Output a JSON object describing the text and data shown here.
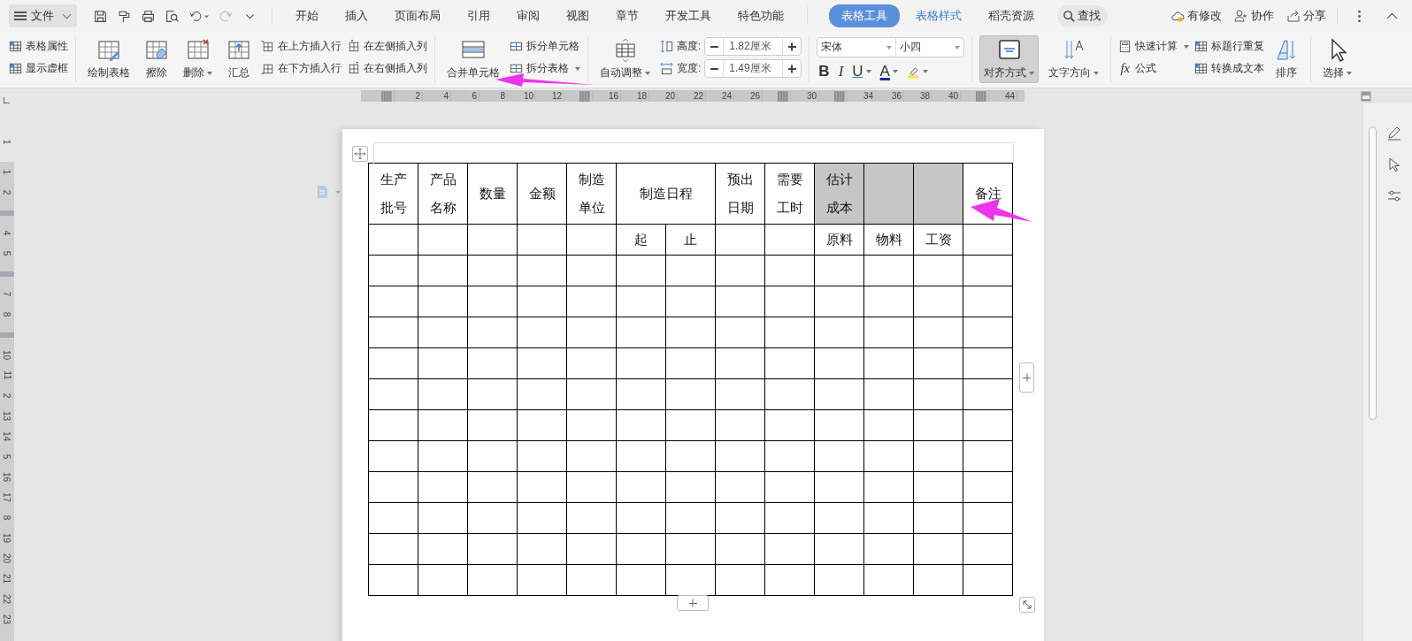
{
  "title_bar": {
    "file_menu": "文件",
    "search": "查找",
    "tabs": [
      {
        "label": "开始",
        "selected": false,
        "contextual": false
      },
      {
        "label": "插入",
        "selected": false,
        "contextual": false
      },
      {
        "label": "页面布局",
        "selected": false,
        "contextual": false
      },
      {
        "label": "引用",
        "selected": false,
        "contextual": false
      },
      {
        "label": "审阅",
        "selected": false,
        "contextual": false
      },
      {
        "label": "视图",
        "selected": false,
        "contextual": false
      },
      {
        "label": "章节",
        "selected": false,
        "contextual": false
      },
      {
        "label": "开发工具",
        "selected": false,
        "contextual": false
      },
      {
        "label": "特色功能",
        "selected": false,
        "contextual": false
      },
      {
        "label": "表格工具",
        "selected": true,
        "contextual": true
      },
      {
        "label": "表格样式",
        "selected": false,
        "contextual": true
      },
      {
        "label": "稻壳资源",
        "selected": false,
        "contextual": false
      }
    ],
    "actions": [
      {
        "label": "有修改"
      },
      {
        "label": "协作"
      },
      {
        "label": "分享"
      }
    ]
  },
  "ribbon": {
    "table_options": [
      {
        "label": "表格属性"
      },
      {
        "label": "显示虚框"
      }
    ],
    "draw_buttons": [
      {
        "label": "绘制表格",
        "dropdown": false
      },
      {
        "label": "擦除",
        "dropdown": false
      },
      {
        "label": "删除",
        "dropdown": true
      },
      {
        "label": "汇总",
        "dropdown": false
      }
    ],
    "insert_buttons": [
      {
        "label": "在上方插入行"
      },
      {
        "label": "在下方插入行"
      },
      {
        "label": "在左侧插入列"
      },
      {
        "label": "在右侧插入列"
      }
    ],
    "merge_button": {
      "label": "合并单元格"
    },
    "split_buttons": [
      {
        "label": "拆分单元格",
        "dropdown": false
      },
      {
        "label": "拆分表格",
        "dropdown": true
      }
    ],
    "autofit_button": {
      "label": "自动调整",
      "dropdown": true
    },
    "size_fields": [
      {
        "label": "高度:",
        "value": "1.82厘米"
      },
      {
        "label": "宽度:",
        "value": "1.49厘米"
      }
    ],
    "font": {
      "family": "宋体",
      "size": "小四"
    },
    "format_buttons": [
      {
        "kind": "text",
        "label": "B",
        "dropdown": false
      },
      {
        "kind": "text",
        "label": "I",
        "dropdown": false
      },
      {
        "kind": "text",
        "label": "U",
        "dropdown": true
      },
      {
        "kind": "text",
        "label": "A",
        "dropdown": true
      },
      {
        "kind": "highlight",
        "dropdown": true
      }
    ],
    "align_buttons": [
      {
        "label": "对齐方式",
        "dropdown": true,
        "pressed": true
      },
      {
        "label": "文字方向",
        "dropdown": true,
        "pressed": false
      }
    ],
    "calc_buttons": [
      {
        "label": "快速计算",
        "dropdown": true
      },
      {
        "icon_text": "fx",
        "label": "公式",
        "dropdown": false
      }
    ],
    "header_buttons": [
      {
        "label": "标题行重复"
      },
      {
        "label": "转换成文本"
      }
    ],
    "sort_button": {
      "label": "排序"
    },
    "select_button": {
      "label": "选择",
      "dropdown": true
    }
  },
  "ruler": [
    {
      "kind": "number",
      "label": "2"
    },
    {
      "kind": "number",
      "label": "4"
    },
    {
      "kind": "number",
      "label": "6"
    },
    {
      "kind": "number",
      "label": "8"
    },
    {
      "kind": "number",
      "label": "10"
    },
    {
      "kind": "number",
      "label": "12"
    },
    {
      "kind": "marker"
    },
    {
      "kind": "number",
      "label": "16"
    },
    {
      "kind": "number",
      "label": "18"
    },
    {
      "kind": "number",
      "label": "20"
    },
    {
      "kind": "number",
      "label": "22"
    },
    {
      "kind": "number",
      "label": "24"
    },
    {
      "kind": "number",
      "label": "26"
    },
    {
      "kind": "marker"
    },
    {
      "kind": "number",
      "label": "30"
    },
    {
      "kind": "marker"
    },
    {
      "kind": "number",
      "label": "34"
    },
    {
      "kind": "number",
      "label": "36"
    },
    {
      "kind": "number",
      "label": "38"
    },
    {
      "kind": "number",
      "label": "40"
    },
    {
      "kind": "marker"
    },
    {
      "kind": "number",
      "label": "44"
    }
  ],
  "vertical_ruler": {
    "top": [
      {
        "kind": "number",
        "label": "1"
      }
    ],
    "body": [
      {
        "kind": "number",
        "label": "1"
      },
      {
        "kind": "number",
        "label": "2"
      },
      {
        "kind": "marker"
      },
      {
        "kind": "number",
        "label": "4"
      },
      {
        "kind": "number",
        "label": "5"
      },
      {
        "kind": "marker"
      },
      {
        "kind": "number",
        "label": "7"
      },
      {
        "kind": "number",
        "label": "8"
      },
      {
        "kind": "marker"
      },
      {
        "kind": "number",
        "label": "10"
      },
      {
        "kind": "number",
        "label": "11"
      },
      {
        "kind": "number",
        "label": "2"
      },
      {
        "kind": "number",
        "label": "13"
      },
      {
        "kind": "number",
        "label": "14"
      },
      {
        "kind": "number",
        "label": "5"
      },
      {
        "kind": "number",
        "label": "16"
      },
      {
        "kind": "number",
        "label": "17"
      },
      {
        "kind": "number",
        "label": "8"
      },
      {
        "kind": "number",
        "label": "19"
      },
      {
        "kind": "number",
        "label": "20"
      },
      {
        "kind": "number",
        "label": "21"
      },
      {
        "kind": "number",
        "label": "22"
      },
      {
        "kind": "number",
        "label": "23"
      }
    ]
  },
  "table": {
    "header_rows": [
      [
        {
          "lines": [
            "生产",
            "批号"
          ],
          "merged": false,
          "selected": false
        },
        {
          "lines": [
            "产品",
            "名称"
          ],
          "merged": false,
          "selected": false
        },
        {
          "lines": [
            "数量"
          ],
          "merged": false,
          "selected": false
        },
        {
          "lines": [
            "金额"
          ],
          "merged": false,
          "selected": false
        },
        {
          "lines": [
            "制造",
            "单位"
          ],
          "merged": false,
          "selected": false
        },
        {
          "lines": [
            "制造日程"
          ],
          "merged": true,
          "selected": false
        },
        {
          "lines": [
            "预出",
            "日期"
          ],
          "merged": false,
          "selected": false
        },
        {
          "lines": [
            "需要",
            "工时"
          ],
          "merged": false,
          "selected": false
        },
        {
          "lines": [
            "估计",
            "成本"
          ],
          "merged": false,
          "selected": true
        },
        {
          "merged": false,
          "selected": true
        },
        {
          "merged": false,
          "selected": true
        },
        {
          "lines": [
            "备注"
          ],
          "merged": false,
          "selected": false
        }
      ],
      [
        {
          "merged": false,
          "selected": false
        },
        {
          "merged": false,
          "selected": false
        },
        {
          "merged": false,
          "selected": false
        },
        {
          "merged": false,
          "selected": false
        },
        {
          "merged": false,
          "selected": false
        },
        {
          "lines": [
            "起"
          ],
          "merged": false,
          "selected": false
        },
        {
          "lines": [
            "止"
          ],
          "merged": false,
          "selected": false
        },
        {
          "merged": false,
          "selected": false
        },
        {
          "merged": false,
          "selected": false
        },
        {
          "lines": [
            "原料"
          ],
          "merged": false,
          "selected": false
        },
        {
          "lines": [
            "物料"
          ],
          "merged": false,
          "selected": false
        },
        {
          "lines": [
            "工资"
          ],
          "merged": false,
          "selected": false
        },
        {
          "merged": false,
          "selected": false
        }
      ]
    ],
    "body_rows": [
      {
        "selected": false
      },
      {
        "selected": false
      },
      {
        "selected": false
      },
      {
        "selected": false
      },
      {
        "selected": false
      },
      {
        "selected": false
      },
      {
        "selected": false
      },
      {
        "selected": false
      },
      {
        "selected": false
      },
      {
        "selected": false
      },
      {
        "selected": false
      }
    ]
  }
}
